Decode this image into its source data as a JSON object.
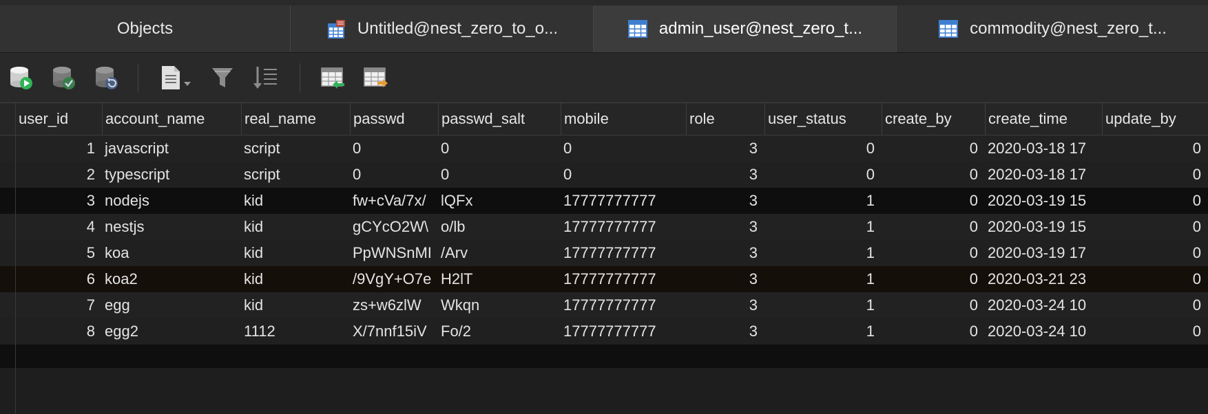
{
  "tabs": [
    {
      "label": "Objects",
      "icon": "objects-tab"
    },
    {
      "label": "Untitled@nest_zero_to_o...",
      "icon": "query-table-icon"
    },
    {
      "label": "admin_user@nest_zero_t...",
      "icon": "table-icon"
    },
    {
      "label": "commodity@nest_zero_t...",
      "icon": "table-icon"
    }
  ],
  "toolbar": {
    "icons": [
      "begin-transaction-icon",
      "commit-icon",
      "rollback-icon",
      "text-view-icon",
      "filter-icon",
      "sort-icon",
      "import-icon",
      "export-icon"
    ]
  },
  "columns": [
    "user_id",
    "account_name",
    "real_name",
    "passwd",
    "passwd_salt",
    "mobile",
    "role",
    "user_status",
    "create_by",
    "create_time",
    "update_by"
  ],
  "rows": [
    {
      "user_id": "1",
      "account_name": "javascript",
      "real_name": "script",
      "passwd": "0",
      "passwd_salt": "0",
      "mobile": "0",
      "role": "3",
      "user_status": "0",
      "create_by": "0",
      "create_time": "2020-03-18 17",
      "update_by": "0"
    },
    {
      "user_id": "2",
      "account_name": "typescript",
      "real_name": "script",
      "passwd": "0",
      "passwd_salt": "0",
      "mobile": "0",
      "role": "3",
      "user_status": "0",
      "create_by": "0",
      "create_time": "2020-03-18 17",
      "update_by": "0"
    },
    {
      "user_id": "3",
      "account_name": "nodejs",
      "real_name": "kid",
      "passwd": "fw+cVa/7x/",
      "passwd_salt": "lQFx",
      "mobile": "17777777777",
      "role": "3",
      "user_status": "1",
      "create_by": "0",
      "create_time": "2020-03-19 15",
      "update_by": "0"
    },
    {
      "user_id": "4",
      "account_name": "nestjs",
      "real_name": "kid",
      "passwd": "gCYcO2W\\",
      "passwd_salt": "o/lb",
      "mobile": "17777777777",
      "role": "3",
      "user_status": "1",
      "create_by": "0",
      "create_time": "2020-03-19 15",
      "update_by": "0"
    },
    {
      "user_id": "5",
      "account_name": "koa",
      "real_name": "kid",
      "passwd": "PpWNSnMI",
      "passwd_salt": "/Arv",
      "mobile": "17777777777",
      "role": "3",
      "user_status": "1",
      "create_by": "0",
      "create_time": "2020-03-19 17",
      "update_by": "0"
    },
    {
      "user_id": "6",
      "account_name": "koa2",
      "real_name": "kid",
      "passwd": "/9VgY+O7e",
      "passwd_salt": "H2lT",
      "mobile": "17777777777",
      "role": "3",
      "user_status": "1",
      "create_by": "0",
      "create_time": "2020-03-21 23",
      "update_by": "0"
    },
    {
      "user_id": "7",
      "account_name": "egg",
      "real_name": "kid",
      "passwd": "zs+w6zlW",
      "passwd_salt": "Wkqn",
      "mobile": "17777777777",
      "role": "3",
      "user_status": "1",
      "create_by": "0",
      "create_time": "2020-03-24 10",
      "update_by": "0"
    },
    {
      "user_id": "8",
      "account_name": "egg2",
      "real_name": "1112",
      "passwd": "X/7nnf15iV",
      "passwd_salt": "Fo/2",
      "mobile": "17777777777",
      "role": "3",
      "user_status": "1",
      "create_by": "0",
      "create_time": "2020-03-24 10",
      "update_by": "0"
    }
  ],
  "colors": {
    "icon_blue": "#3f7fd0",
    "icon_green": "#2fb457",
    "icon_red": "#b84a3a",
    "icon_orange": "#e79a2e"
  }
}
